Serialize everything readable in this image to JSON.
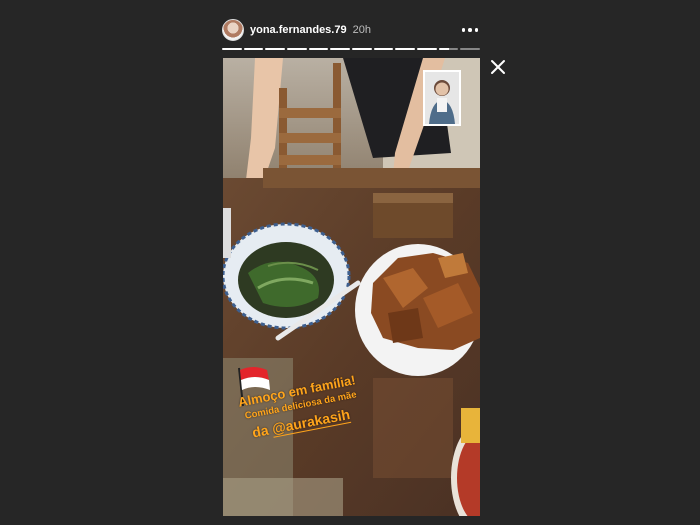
{
  "header": {
    "username": "yona.fernandes.79",
    "time": "20h"
  },
  "icons": {
    "avatar": "profile-avatar",
    "more": "more-horizontal-icon",
    "close": "close-icon",
    "flag": "indonesia-flag-sticker"
  },
  "progress": {
    "segments": [
      1,
      1,
      1,
      1,
      1,
      1,
      1,
      1,
      1,
      1,
      0.5,
      0
    ],
    "active_index": 10
  },
  "story": {
    "caption_line1": "Almoço em família!",
    "caption_line2": "Comida deliciosa da mãe",
    "caption_prefix": "da ",
    "mention": "@aurakasih"
  },
  "colors": {
    "background": "#262626",
    "caption": "#ffa41b"
  }
}
